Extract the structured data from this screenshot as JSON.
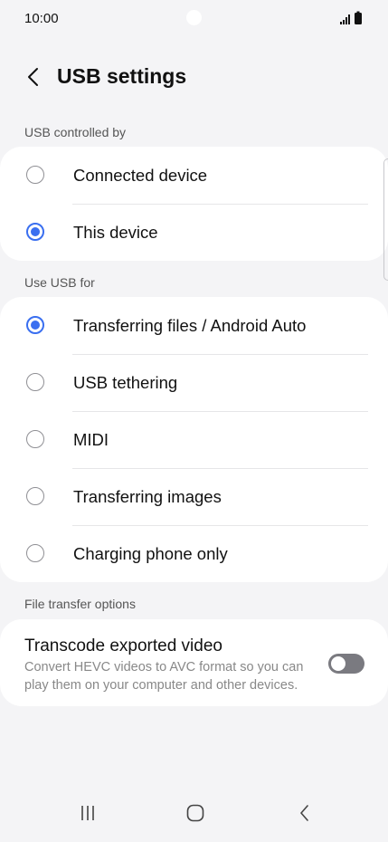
{
  "status_bar": {
    "time": "10:00"
  },
  "header": {
    "title": "USB settings"
  },
  "sections": {
    "controlled_by": "USB controlled by",
    "use_usb_for": "Use USB for",
    "file_transfer": "File transfer options"
  },
  "controlled_by_options": [
    {
      "label": "Connected device",
      "selected": false
    },
    {
      "label": "This device",
      "selected": true
    }
  ],
  "use_usb_options": [
    {
      "label": "Transferring files / Android Auto",
      "selected": true
    },
    {
      "label": "USB tethering",
      "selected": false
    },
    {
      "label": "MIDI",
      "selected": false
    },
    {
      "label": "Transferring images",
      "selected": false
    },
    {
      "label": "Charging phone only",
      "selected": false
    }
  ],
  "transcode": {
    "title": "Transcode exported video",
    "description": "Convert HEVC videos to AVC format so you can play them on your computer and other devices.",
    "enabled": false
  },
  "colors": {
    "accent": "#3a6ff0",
    "background": "#f4f4f6",
    "toggle_off": "#7a7a80"
  },
  "icons": {
    "back": "chevron-left-icon",
    "recents": "recents-icon",
    "home": "home-icon",
    "nav_back": "back-icon"
  }
}
